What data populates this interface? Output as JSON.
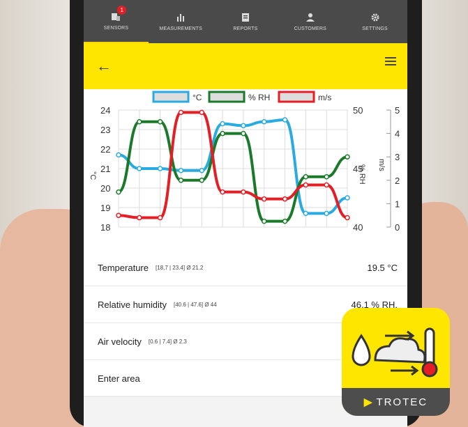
{
  "tabs": [
    {
      "label": "SENSORS",
      "icon": "sensors-icon",
      "active": true,
      "badge": "1"
    },
    {
      "label": "MEASUREMENTS",
      "icon": "bar-chart-icon",
      "active": false
    },
    {
      "label": "REPORTS",
      "icon": "report-icon",
      "active": false
    },
    {
      "label": "CUSTOMERS",
      "icon": "customers-icon",
      "active": false
    },
    {
      "label": "SETTINGS",
      "icon": "gear-icon",
      "active": false
    }
  ],
  "header": {
    "accent": "#ffe600"
  },
  "chart_data": {
    "type": "line",
    "legend": [
      "°C",
      "% RH",
      "m/s"
    ],
    "colors": {
      "temp": "#29abe2",
      "rh": "#1a7a2a",
      "vel": "#e31e24"
    },
    "axes": {
      "left": {
        "label": "°C",
        "ticks": [
          "18",
          "19",
          "20",
          "21",
          "22",
          "23",
          "24"
        ],
        "ylim": [
          18,
          24
        ]
      },
      "middle": {
        "label": "% RH",
        "ticks": [
          "40",
          "45",
          "50"
        ],
        "ylim": [
          40,
          50
        ]
      },
      "right": {
        "label": "m/s",
        "ticks": [
          "0",
          "1",
          "2",
          "3",
          "4",
          "5"
        ],
        "ylim": [
          0,
          5
        ]
      }
    },
    "series": [
      {
        "name": "°C",
        "axis": "left",
        "values": [
          21.7,
          21.0,
          21.0,
          20.9,
          20.9,
          23.3,
          23.2,
          23.4,
          23.5,
          18.7,
          18.7,
          19.5
        ]
      },
      {
        "name": "% RH",
        "axis": "middle",
        "values": [
          43.0,
          49.0,
          49.0,
          44.0,
          44.0,
          48.0,
          48.0,
          40.5,
          40.5,
          44.3,
          44.3,
          46.0
        ]
      },
      {
        "name": "m/s",
        "axis": "right",
        "values": [
          0.5,
          0.4,
          0.4,
          4.9,
          4.9,
          1.5,
          1.5,
          1.2,
          1.2,
          1.8,
          1.8,
          0.4
        ]
      }
    ]
  },
  "readings": [
    {
      "name": "Temperature",
      "range": "[18,7 | 23.4]  Ø 21.2",
      "value": "19.5 °C"
    },
    {
      "name": "Relative humidity",
      "range": "[40.6 | 47.6]  Ø 44",
      "value": "46.1 % RH."
    },
    {
      "name": "Air velocity",
      "range": "[0.6 | 7.4]  Ø 2.3",
      "value": ""
    },
    {
      "name": "Enter area",
      "range": "",
      "value": ""
    }
  ],
  "brand": {
    "name": "TROTEC",
    "mark": "▶"
  }
}
